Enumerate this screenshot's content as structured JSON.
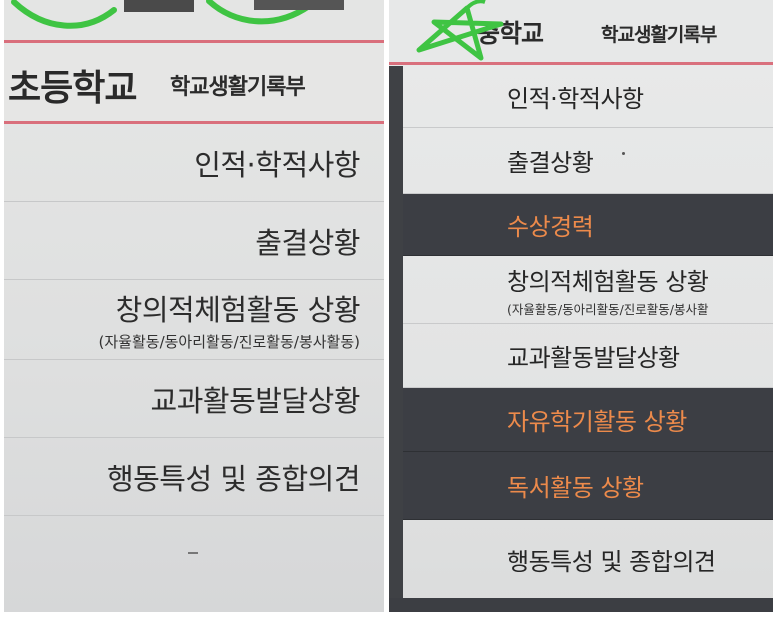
{
  "left": {
    "school": "초등학교",
    "record": "학교생활기록부",
    "rows": [
      {
        "label": "인적·학적사항"
      },
      {
        "label": "출결상황"
      },
      {
        "label": "창의적체험활동 상황",
        "sub": "(자율활동/동아리활동/진로활동/봉사활동)"
      },
      {
        "label": "교과활동발달상황"
      },
      {
        "label": "행동특성 및 종합의견"
      }
    ],
    "last_mark": "-"
  },
  "right": {
    "school": "중학교",
    "record": "학교생활기록부",
    "rows": [
      {
        "label": "인적·학적사항",
        "dark": false
      },
      {
        "label": "출결상황",
        "dark": false
      },
      {
        "label": "수상경력",
        "dark": true
      },
      {
        "label": "창의적체험활동 상황",
        "sub": "(자율활동/동아리활동/진로활동/봉사활",
        "dark": false
      },
      {
        "label": "교과활동발달상황",
        "dark": false
      },
      {
        "label": "자유학기활동 상황",
        "dark": true
      },
      {
        "label": "독서활동 상황",
        "dark": true
      },
      {
        "label": "행동특성 및 종합의견",
        "dark": false
      }
    ]
  },
  "colors": {
    "highlight_text": "#ec8a4b",
    "dark_row": "#3c3e44",
    "red_line": "#d96f7c",
    "marker_green": "#3fc443"
  }
}
